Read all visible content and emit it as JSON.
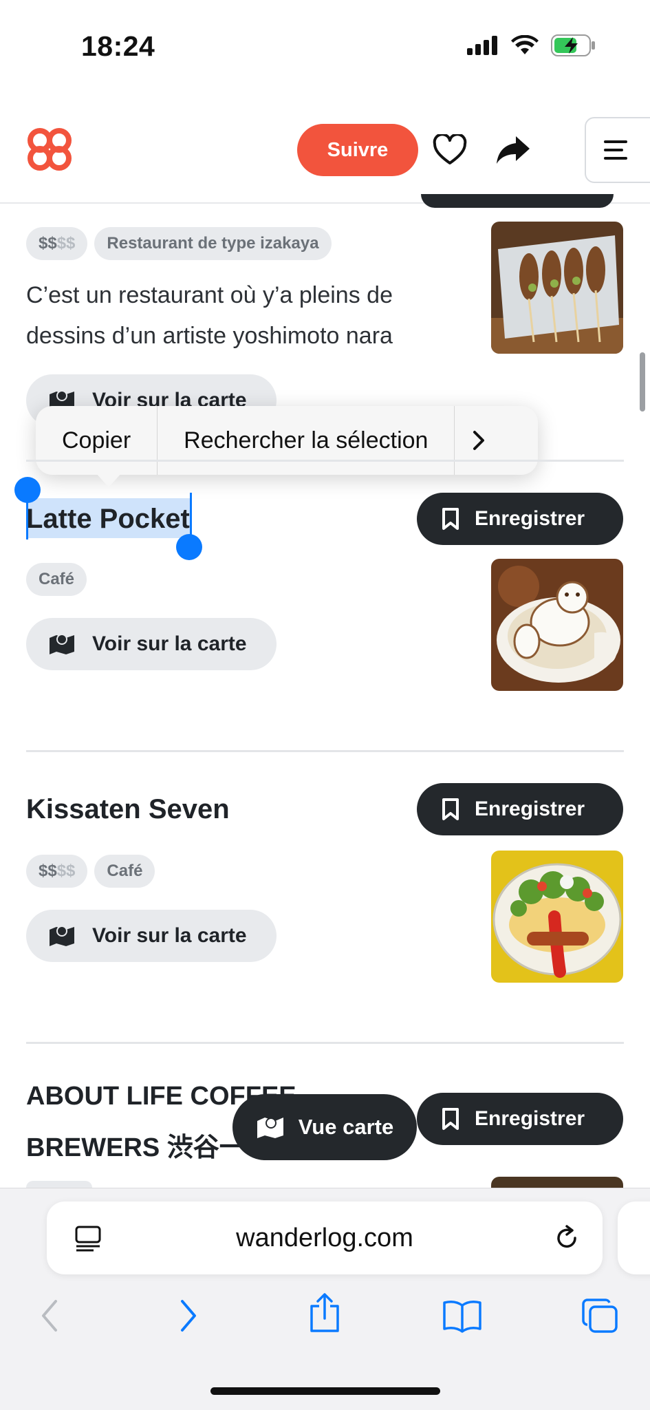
{
  "status_bar": {
    "time": "18:24",
    "battery_color": "#34c759"
  },
  "header": {
    "follow_label": "Suivre",
    "brand_color": "#f2543d"
  },
  "places": [
    {
      "name": "",
      "price_strong": "$$",
      "price_dim": "$$",
      "tags": [
        "Restaurant de type izakaya"
      ],
      "description": "C’est un restaurant où y’a pleins de dessins d’un artiste yoshimoto nara",
      "map_label": "Voir sur la carte"
    },
    {
      "name": "Latte Pocket",
      "tags": [
        "Café"
      ],
      "map_label": "Voir sur la carte",
      "save_label": "Enregistrer"
    },
    {
      "name": "Kissaten Seven",
      "price_strong": "$$",
      "price_dim": "$$",
      "tags": [
        "Café"
      ],
      "map_label": "Voir sur la carte",
      "save_label": "Enregistrer"
    },
    {
      "name_line1": "ABOUT LIFE COFFEE",
      "name_line2": "BREWERS 渋谷一",
      "save_label": "Enregistrer"
    }
  ],
  "context_menu": {
    "copy": "Copier",
    "lookup": "Rechercher la sélection",
    "more": "›"
  },
  "floating": {
    "map_view_label": "Vue carte"
  },
  "browser": {
    "url": "wanderlog.com"
  },
  "selection_color": "#0a7aff"
}
